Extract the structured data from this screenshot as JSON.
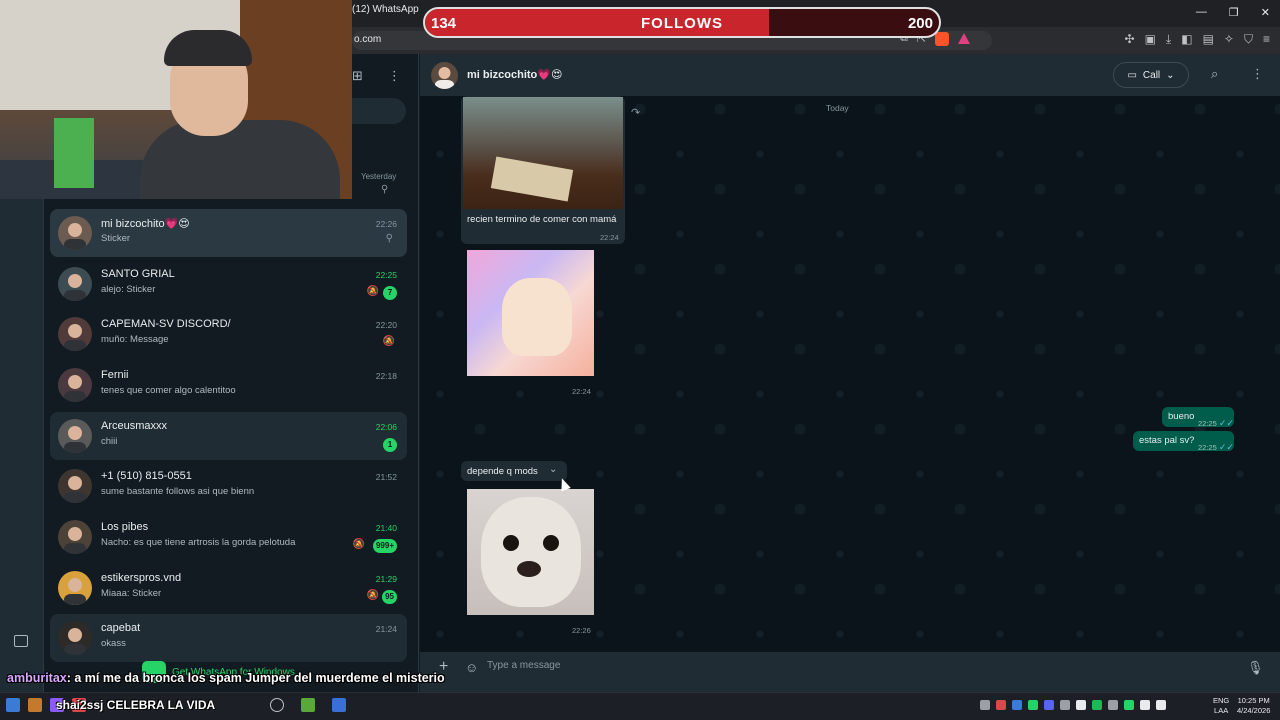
{
  "browser": {
    "tab_title": "(12) WhatsApp",
    "address": "o.com"
  },
  "follow_goal": {
    "current": "134",
    "label": "FOLLOWS",
    "goal": "200",
    "progress_fraction": 0.67
  },
  "chat_list": {
    "pinned_time": "Yesterday",
    "items": [
      {
        "name": "mi bizcochito💗😍",
        "preview": "Sticker",
        "time": "22:26",
        "unread": "",
        "state": "selected"
      },
      {
        "name": "SANTO GRIAL",
        "preview": "alejo: Sticker",
        "time": "22:25",
        "unread": "7",
        "state": "normal"
      },
      {
        "name": "CAPEMAN-SV DISCORD/",
        "preview": "muño: Message",
        "time": "22:20",
        "unread": "",
        "state": "normal"
      },
      {
        "name": "Fernii",
        "preview": "tenes que comer algo calentitoo",
        "time": "22:18",
        "unread": "",
        "state": "normal"
      },
      {
        "name": "Arceusmaxxx",
        "preview": "chiii",
        "time": "22:06",
        "unread": "1",
        "state": "hover"
      },
      {
        "name": "+1 (510) 815-0551",
        "preview": "sume bastante follows asi que bienn",
        "time": "21:52",
        "unread": "",
        "state": "normal"
      },
      {
        "name": "Los pibes",
        "preview": "Nacho: es que tiene artrosis la gorda pelotuda",
        "time": "21:40",
        "unread": "999+",
        "state": "normal"
      },
      {
        "name": "estikerspros.vnd",
        "preview": "Miaaa: Sticker",
        "time": "21:29",
        "unread": "95",
        "state": "normal"
      },
      {
        "name": "capebat",
        "preview": "okass",
        "time": "21:24",
        "unread": "",
        "state": "hover"
      }
    ]
  },
  "conversation": {
    "title": "mi bizcochito💗😍",
    "call_label": "Call",
    "date_label": "Today",
    "messages": {
      "m1_text": "recien termino de comer con mamá",
      "m1_time": "22:24",
      "m2_time": "22:24",
      "m3_text": "bueno",
      "m3_time": "22:25",
      "m4_text": "estas pal sv?",
      "m4_time": "22:25",
      "m5_text": "depende q mods",
      "m6_time": "22:26"
    },
    "composer_placeholder": "Type a message"
  },
  "stream_overlay": {
    "get_whatsapp": "Get WhatsApp for Windows",
    "chat_user": "amburitax",
    "chat_message": ": a mí me da bronca los spam Jumper del muerdeme el misterio",
    "second_line": "shai2ssj CELEBRA LA VIDA"
  },
  "taskbar": {
    "lang_top": "ENG",
    "lang_bottom": "LAA",
    "time": "10:25 PM",
    "date": "4/24/2026"
  },
  "colors": {
    "accent_green": "#25d366",
    "follow_bar": "#c8262c",
    "outgoing_bubble": "#005c4b",
    "incoming_bubble": "#202c33"
  }
}
